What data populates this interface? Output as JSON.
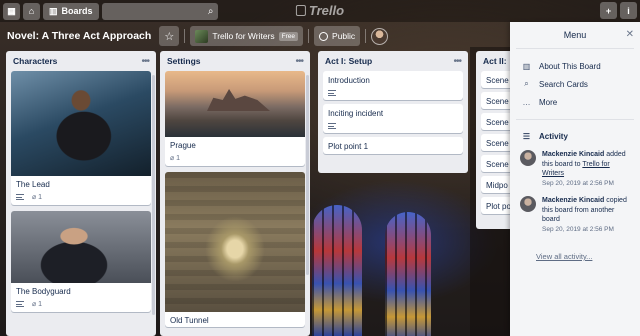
{
  "header": {
    "boards_label": "Boards",
    "logo_text": "Trello",
    "add_label": "+",
    "info_label": "i"
  },
  "board": {
    "title": "Novel: A Three Act Approach",
    "team_name": "Trello for Writers",
    "team_badge": "Free",
    "visibility": "Public"
  },
  "lists": [
    {
      "title": "Characters",
      "cards": [
        {
          "title": "The Lead",
          "attachments": "1"
        },
        {
          "title": "The Bodyguard",
          "attachments": "1"
        }
      ]
    },
    {
      "title": "Settings",
      "cards": [
        {
          "title": "Prague",
          "attachments": "1"
        },
        {
          "title": "Old Tunnel"
        }
      ]
    },
    {
      "title": "Act I: Setup",
      "cards": [
        {
          "title": "Introduction"
        },
        {
          "title": "Inciting incident"
        },
        {
          "title": "Plot point 1"
        }
      ]
    },
    {
      "title": "Act II:",
      "cards": [
        {
          "title": "Scene"
        },
        {
          "title": "Scene"
        },
        {
          "title": "Scene"
        },
        {
          "title": "Scene"
        },
        {
          "title": "Scene"
        },
        {
          "title": "Midpo"
        },
        {
          "title": "Plot po"
        }
      ]
    }
  ],
  "menu": {
    "title": "Menu",
    "items": [
      {
        "label": "About This Board"
      },
      {
        "label": "Search Cards"
      },
      {
        "label": "More"
      }
    ],
    "activity_label": "Activity",
    "activity": [
      {
        "user": "Mackenzie Kincaid",
        "action": "added this board to",
        "link": "Trello for Writers",
        "time": "Sep 20, 2019 at 2:56 PM"
      },
      {
        "user": "Mackenzie Kincaid",
        "action": "copied this board from another board",
        "link": "",
        "time": "Sep 20, 2019 at 2:56 PM"
      }
    ],
    "view_all": "View all activity..."
  }
}
